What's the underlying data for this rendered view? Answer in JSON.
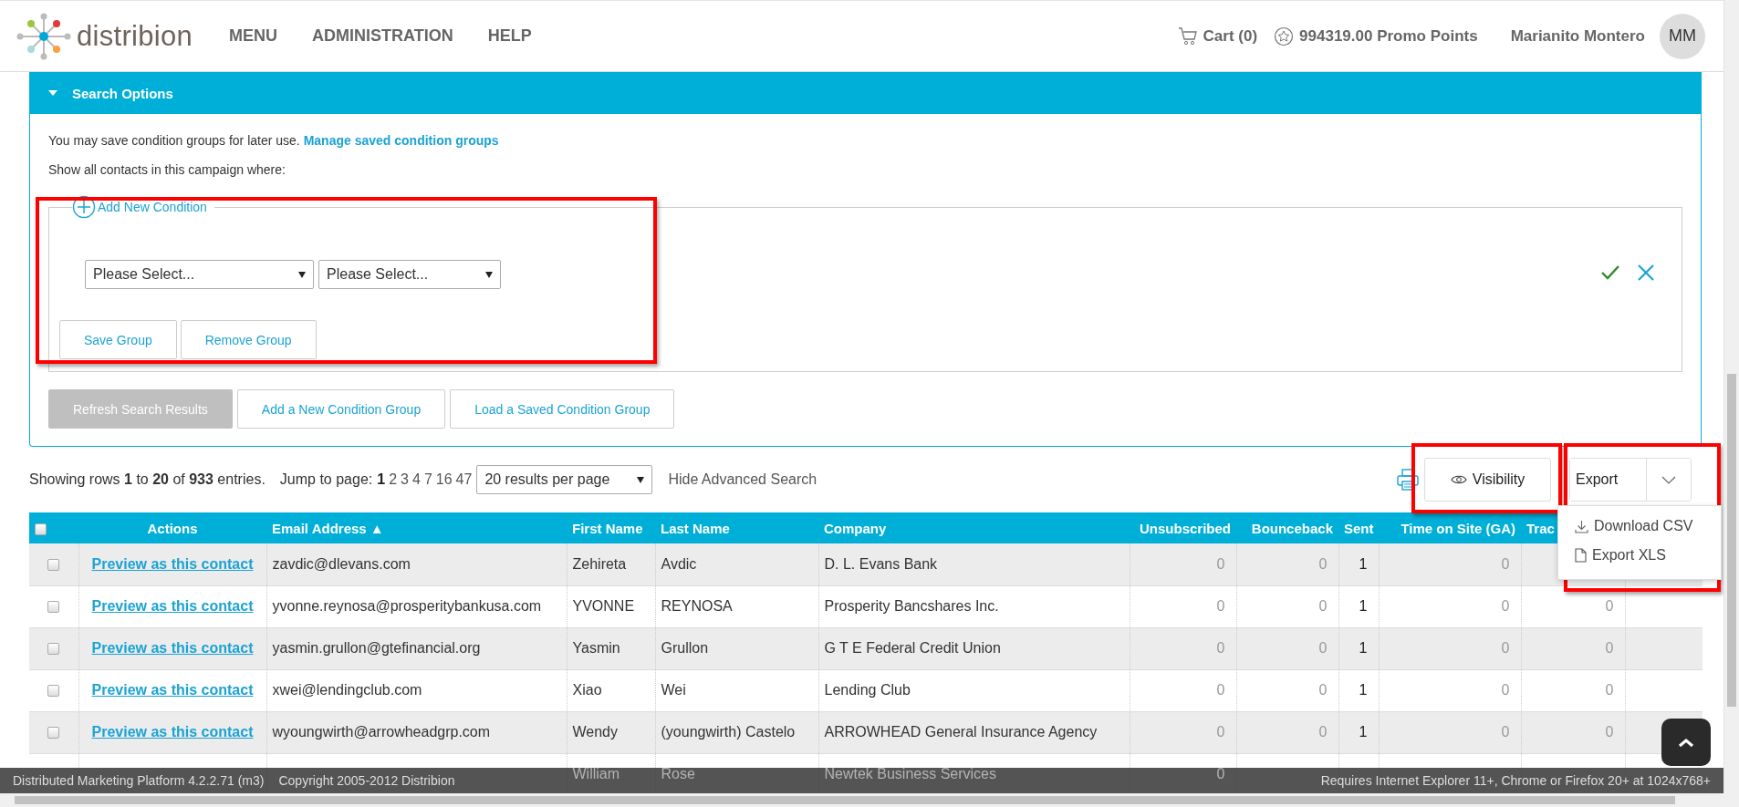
{
  "header": {
    "logo_text": "distribion",
    "nav": [
      {
        "label": "MENU"
      },
      {
        "label": "ADMINISTRATION"
      },
      {
        "label": "HELP"
      }
    ],
    "cart": "Cart (0)",
    "promo": "994319.00 Promo Points",
    "user": "Marianito Montero",
    "avatar": "MM"
  },
  "search_options": {
    "title": "Search Options",
    "expanded": true,
    "intro": "You may save condition groups for later use.",
    "manage_link": "Manage saved condition groups",
    "show_text": "Show all contacts in this campaign where:",
    "condition_group": {
      "highlighted": true,
      "add_label": "Add New Condition",
      "selects": [
        {
          "value": "Please Select..."
        },
        {
          "value": "Please Select..."
        }
      ],
      "buttons": [
        {
          "label": "Save Group"
        },
        {
          "label": "Remove Group"
        }
      ]
    },
    "actions": [
      {
        "label": "Refresh Search Results",
        "disabled": true
      },
      {
        "label": "Add a New Condition Group",
        "disabled": false
      },
      {
        "label": "Load a Saved Condition Group",
        "disabled": false
      }
    ]
  },
  "results": {
    "summary": "Showing rows **1** to **20** of **933** entries.",
    "jump_label": "Jump to page:",
    "pages": [
      {
        "label": "1",
        "selected": true
      },
      {
        "label": "2",
        "selected": false
      },
      {
        "label": "3",
        "selected": false
      },
      {
        "label": "4",
        "selected": false
      },
      {
        "label": "7",
        "selected": false
      },
      {
        "label": "16",
        "selected": false
      },
      {
        "label": "47",
        "selected": false
      }
    ],
    "per_page": "20 results per page",
    "hide_link": "Hide Advanced Search",
    "visibility": {
      "label": "Visibility",
      "highlighted": true
    },
    "export": {
      "label": "Export",
      "highlighted": true,
      "expanded": true,
      "items": [
        {
          "label": "Download CSV",
          "kind": "download"
        },
        {
          "label": "Export XLS",
          "kind": "file"
        }
      ]
    }
  },
  "table": {
    "select_all_checked": false,
    "columns": [
      {
        "label": "Actions"
      },
      {
        "label": "Email Address ▲"
      },
      {
        "label": "First Name"
      },
      {
        "label": "Last Name"
      },
      {
        "label": "Company"
      },
      {
        "label": "Unsubscribed"
      },
      {
        "label": "Bounceback"
      },
      {
        "label": "Sent"
      },
      {
        "label": "Time on Site (GA)"
      },
      {
        "label": "Trac"
      }
    ],
    "rows": [
      {
        "checked": false,
        "actions": "Preview as this contact",
        "email": "zavdic@dlevans.com",
        "first": "Zehireta",
        "last": "Avdic",
        "company": "D. L. Evans Bank",
        "unsubscribed": "0",
        "bounceback": "0",
        "sent": "1",
        "time": "0"
      },
      {
        "checked": false,
        "actions": "Preview as this contact",
        "email": "yvonne.reynosa@prosperitybankusa.com",
        "first": "YVONNE",
        "last": "REYNOSA",
        "company": "Prosperity Bancshares Inc.",
        "unsubscribed": "0",
        "bounceback": "0",
        "sent": "1",
        "time": "0",
        "column_11": "0"
      },
      {
        "checked": false,
        "actions": "Preview as this contact",
        "email": "yasmin.grullon@gtefinancial.org",
        "first": "Yasmin",
        "last": "Grullon",
        "company": "G T E Federal Credit Union",
        "unsubscribed": "0",
        "bounceback": "0",
        "sent": "1",
        "time": "0",
        "column_11": "0"
      },
      {
        "checked": false,
        "actions": "Preview as this contact",
        "email": "xwei@lendingclub.com",
        "first": "Xiao",
        "last": "Wei",
        "company": "Lending Club",
        "unsubscribed": "0",
        "bounceback": "0",
        "sent": "1",
        "time": "0",
        "column_11": "0"
      },
      {
        "checked": false,
        "actions": "Preview as this contact",
        "email": "wyoungwirth@arrowheadgrp.com",
        "first": "Wendy",
        "last": "(youngwirth) Castelo",
        "company": "ARROWHEAD General Insurance Agency",
        "unsubscribed": "0",
        "bounceback": "0",
        "sent": "1",
        "time": "0",
        "column_11": "0"
      },
      {
        "covered": true,
        "first": "William",
        "last": "Rose",
        "company": "Newtek Business Services",
        "unsubscribed": "0"
      }
    ]
  },
  "footer": {
    "version": "Distributed Marketing Platform 4.2.2.71 (m3)",
    "copyright": "Copyright 2005-2012 Distribion",
    "requirements": "Requires Internet Explorer 11+, Chrome or Firefox 20+ at 1024x768+"
  }
}
